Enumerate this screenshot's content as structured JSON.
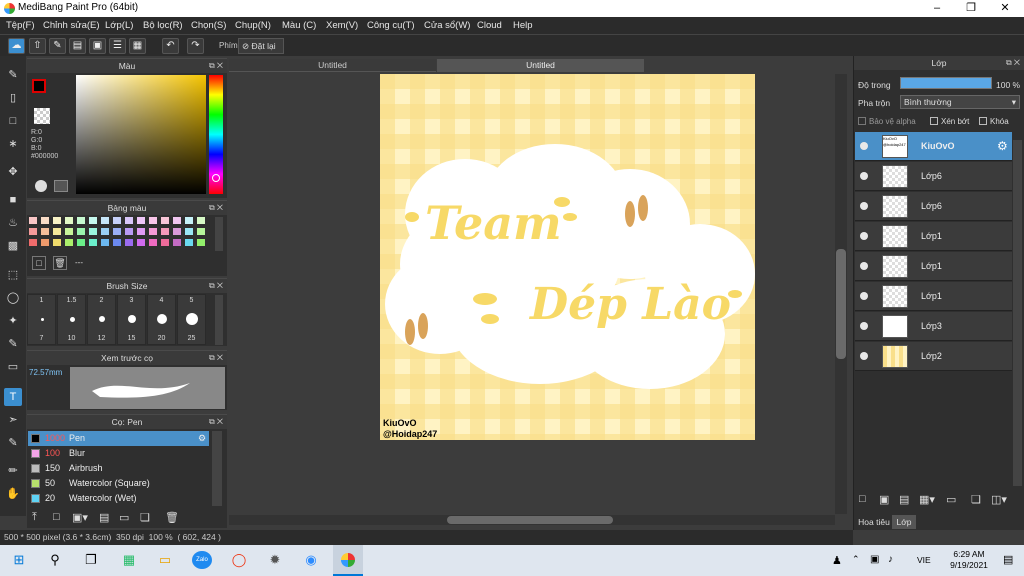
{
  "window": {
    "title": "MediBang Paint Pro (64bit)"
  },
  "menu": [
    "Tệp(F)",
    "Chỉnh sửa(E)",
    "Lớp(L)",
    "Bộ lọc(R)",
    "Chọn(S)",
    "Chụp(N)",
    "Màu (C)",
    "Xem(V)",
    "Công cụ(T)",
    "Cửa sổ(W)",
    "Cloud",
    "Help"
  ],
  "toolbar": {
    "key_label": "Phím",
    "reset_label": "Đặt lại"
  },
  "color_panel": {
    "title": "Màu",
    "r": "R:0",
    "g": "G:0",
    "b": "B:0",
    "hex": "#000000"
  },
  "palette_panel": {
    "title": "Bảng màu",
    "dash": "---"
  },
  "brush_size_panel": {
    "title": "Brush Size",
    "sizes_top": [
      "1",
      "1.5",
      "2",
      "3",
      "4",
      "5"
    ],
    "sizes_bottom": [
      "7",
      "10",
      "12",
      "15",
      "20",
      "25"
    ]
  },
  "preview_panel": {
    "title": "Xem trước cọ",
    "size": "72.57mm"
  },
  "brush_panel": {
    "title": "Cọ: Pen",
    "brushes": [
      {
        "size": "1000",
        "name": "Pen",
        "color": "#000000"
      },
      {
        "size": "100",
        "name": "Blur",
        "color": "#f4a4e8"
      },
      {
        "size": "150",
        "name": "Airbrush",
        "color": "#bdbdbd"
      },
      {
        "size": "50",
        "name": "Watercolor (Square)",
        "color": "#b7e06c"
      },
      {
        "size": "20",
        "name": "Watercolor (Wet)",
        "color": "#5fd3f5"
      }
    ]
  },
  "tabs": [
    "Untitled",
    "Untitled"
  ],
  "artwork": {
    "line1": "Team",
    "line2": "Dép Lào",
    "credit1": "KiuOvO",
    "credit2": "@Hoidap247"
  },
  "layers_panel": {
    "title": "Lớp",
    "opacity_label": "Độ trong",
    "opacity_value": "100 %",
    "opacity": 1.0,
    "blend_label": "Pha trộn",
    "blend_value": "Bình thường",
    "protect_alpha": "Bảo vệ alpha",
    "clipping": "Xén bớt",
    "lock": "Khóa",
    "layers": [
      "KiuOvO",
      "Lớp6",
      "Lớp6",
      "Lớp1",
      "Lớp1",
      "Lớp1",
      "Lớp3",
      "Lớp2"
    ],
    "thumb_text": "KiuOvO @hoidap247",
    "tab_material": "Hoa tiêu",
    "tab_layer": "Lớp"
  },
  "status": {
    "size": "500 * 500 pixel",
    "cm": "(3.6 * 3.6cm)",
    "dpi": "350 dpi",
    "zoom": "100 %",
    "coords": "( 602, 424 )"
  },
  "taskbar": {
    "lang": "VIE",
    "time": "6:29 AM",
    "date": "9/19/2021",
    "zalo": "Zalo"
  },
  "colors": {
    "accent": "#3b8fd0",
    "selected_layer": "#4a90c8",
    "paper": "#fff3c4",
    "gingham": "#f9df8a",
    "lettering": "#f7d967"
  }
}
